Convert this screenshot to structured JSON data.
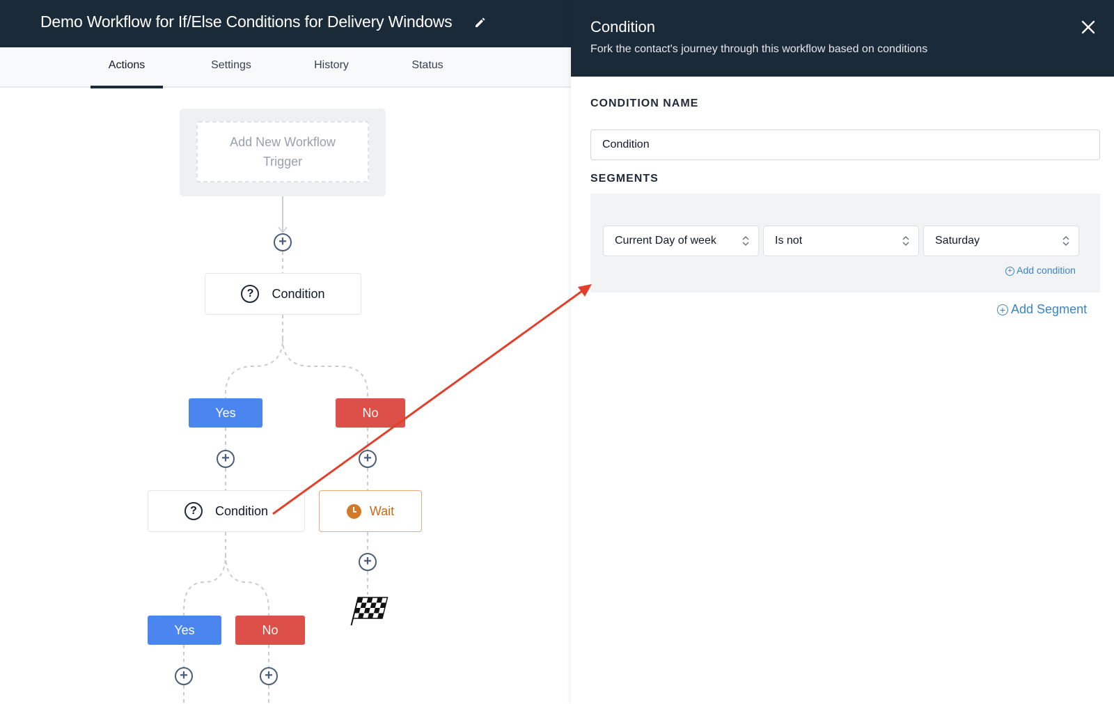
{
  "header": {
    "title": "Demo Workflow for If/Else Conditions for Delivery Windows",
    "edit_icon": "pencil-icon"
  },
  "tabs": [
    {
      "label": "Actions",
      "active": true
    },
    {
      "label": "Settings",
      "active": false
    },
    {
      "label": "History",
      "active": false
    },
    {
      "label": "Status",
      "active": false
    }
  ],
  "canvas": {
    "trigger_label": "Add New Workflow Trigger",
    "condition1_label": "Condition",
    "branch1": {
      "yes": "Yes",
      "no": "No"
    },
    "condition2_label": "Condition",
    "wait_label": "Wait",
    "branch2": {
      "yes": "Yes",
      "no": "No"
    },
    "plus_symbol": "+",
    "question_symbol": "?"
  },
  "panel": {
    "title": "Condition",
    "subtitle": "Fork the contact's journey through this workflow based on conditions",
    "condition_name_label": "CONDITION NAME",
    "condition_name_value": "Condition",
    "segments_label": "SEGMENTS",
    "segment": {
      "field": "Current Day of week",
      "operator": "Is not",
      "value": "Saturday"
    },
    "add_condition": "Add condition",
    "add_segment": "Add Segment"
  },
  "colors": {
    "header_bg": "#1b2a39",
    "yes": "#4b86f0",
    "no": "#dd4f49",
    "link": "#3b84c4",
    "arrow": "#e2402b"
  }
}
